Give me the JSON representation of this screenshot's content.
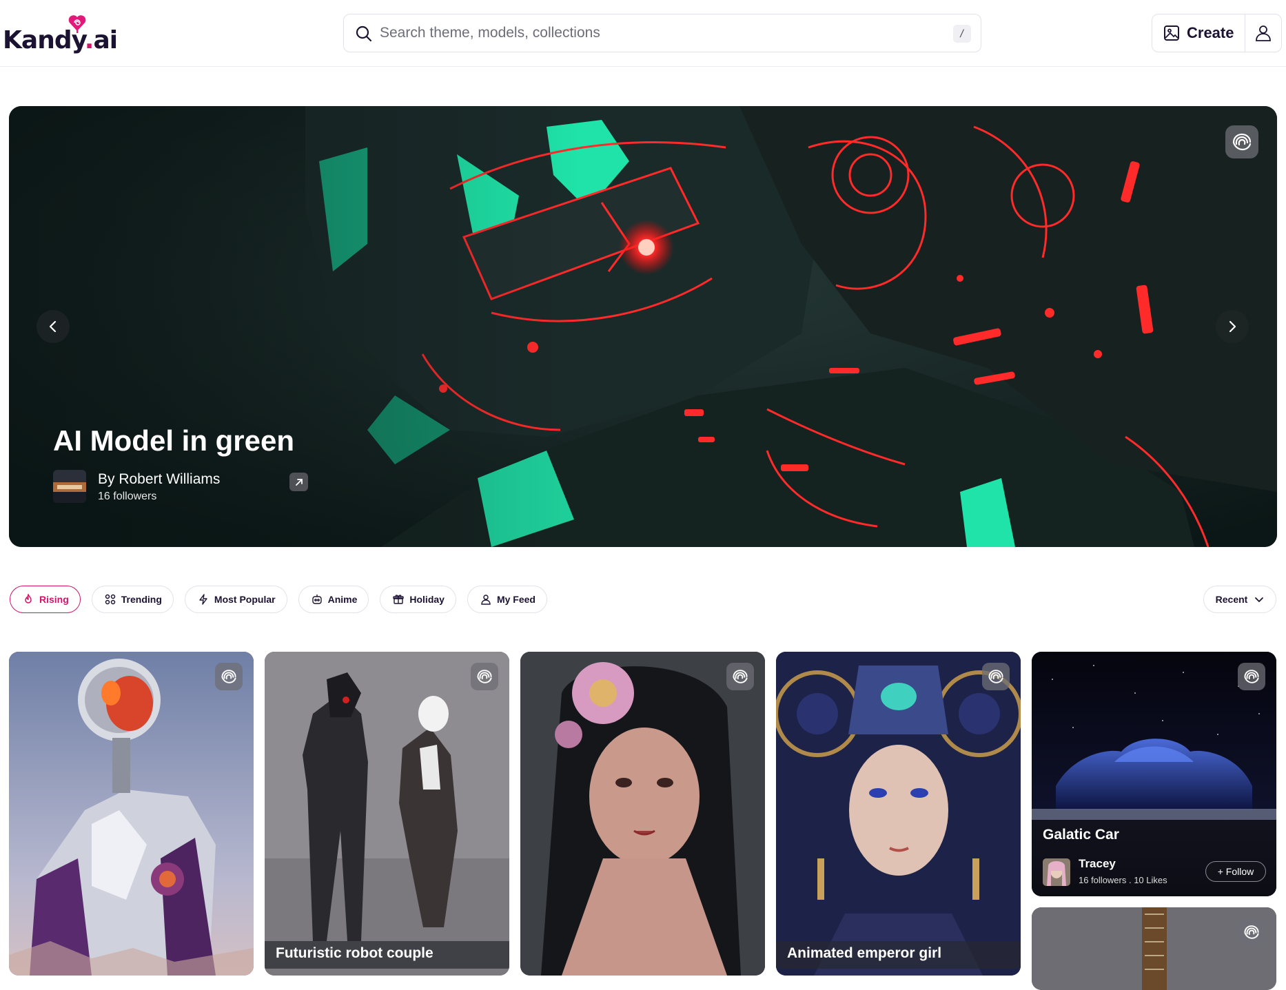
{
  "header": {
    "logo_text_main": "Kandy",
    "logo_text_dot": ".",
    "logo_text_end": "ai",
    "search_placeholder": "Search theme, models, collections",
    "search_shortcut": "/",
    "create_label": "Create"
  },
  "hero": {
    "title": "AI Model in green",
    "author_name": "By Robert Williams",
    "author_followers": "16 followers"
  },
  "filters": [
    {
      "label": "Rising",
      "icon": "flame-icon",
      "active": true
    },
    {
      "label": "Trending",
      "icon": "grid-icon",
      "active": false
    },
    {
      "label": "Most Popular",
      "icon": "bolt-icon",
      "active": false
    },
    {
      "label": "Anime",
      "icon": "robot-icon",
      "active": false
    },
    {
      "label": "Holiday",
      "icon": "gift-icon",
      "active": false
    },
    {
      "label": "My Feed",
      "icon": "user-icon",
      "active": false
    }
  ],
  "sort": {
    "label": "Recent"
  },
  "cards": [
    {
      "caption": ""
    },
    {
      "caption": "Futuristic robot couple"
    },
    {
      "caption": ""
    },
    {
      "caption": "Animated emperor girl"
    },
    {
      "title": "Galatic Car",
      "user": "Tracey",
      "stats": "16 followers . 10 Likes",
      "follow_label": "+ Follow"
    }
  ],
  "colors": {
    "accent": "#d1146a",
    "text_dark": "#1c1232",
    "neon_green": "#1fe3a8",
    "neon_red": "#ff2a2a"
  }
}
